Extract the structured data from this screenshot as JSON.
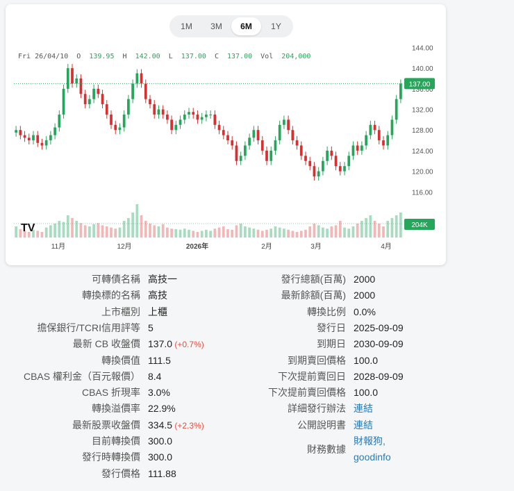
{
  "range_tabs": [
    {
      "label": "1M",
      "active": false
    },
    {
      "label": "3M",
      "active": false
    },
    {
      "label": "6M",
      "active": true
    },
    {
      "label": "1Y",
      "active": false
    }
  ],
  "legend": {
    "date": "Fri 26/04/10",
    "o_label": "O",
    "o": "139.95",
    "h_label": "H",
    "h": "142.00",
    "l_label": "L",
    "l": "137.00",
    "c_label": "C",
    "c": "137.00",
    "vol_label": "Vol",
    "vol": "204,000"
  },
  "chart_data": {
    "type": "candlestick",
    "y_ticks": [
      "144.00",
      "140.00",
      "136.00",
      "132.00",
      "128.00",
      "124.00",
      "120.00",
      "116.00"
    ],
    "y_tick_values": [
      144,
      140,
      136,
      132,
      128,
      124,
      120,
      116
    ],
    "ylim": [
      112,
      145
    ],
    "x_ticks": [
      "11月",
      "12月",
      "2026年",
      "2月",
      "3月",
      "4月"
    ],
    "last_price_label": "137.00",
    "last_price": 137.0,
    "last_volume_label": "204K",
    "up_color": "#26a65b",
    "down_color": "#d63031",
    "closes": [
      128,
      127,
      126.5,
      126,
      127,
      125.5,
      125,
      126,
      127,
      128.5,
      131,
      136,
      140,
      137,
      138,
      135,
      133,
      134,
      136,
      135,
      133,
      131,
      129,
      128,
      128.5,
      131,
      134,
      137,
      139,
      137,
      134,
      133,
      131,
      132,
      131,
      130,
      128,
      129,
      130,
      131,
      131.5,
      131,
      130,
      130.5,
      131,
      131,
      129,
      128,
      127,
      126,
      125,
      122,
      123,
      125,
      126.5,
      128,
      126,
      124,
      122,
      124,
      126,
      129,
      130,
      128,
      126,
      125,
      123,
      122,
      121,
      119,
      120,
      122,
      124,
      123,
      121,
      120,
      121,
      123,
      125,
      124,
      125,
      127,
      129,
      128,
      126,
      125,
      127,
      130,
      134,
      137
    ],
    "volumes": [
      20,
      15,
      12,
      10,
      14,
      12,
      10,
      18,
      22,
      25,
      30,
      28,
      40,
      35,
      30,
      26,
      22,
      20,
      24,
      26,
      22,
      20,
      18,
      16,
      18,
      30,
      35,
      45,
      60,
      40,
      30,
      25,
      22,
      20,
      24,
      18,
      16,
      15,
      14,
      16,
      14,
      12,
      10,
      12,
      14,
      12,
      16,
      18,
      20,
      15,
      14,
      22,
      25,
      20,
      18,
      16,
      14,
      12,
      14,
      16,
      20,
      18,
      16,
      14,
      12,
      10,
      12,
      14,
      20,
      25,
      22,
      18,
      16,
      20,
      22,
      30,
      18,
      16,
      20,
      25,
      30,
      35,
      40,
      30,
      25,
      20,
      30,
      35,
      40,
      45
    ]
  },
  "info_left": [
    {
      "label": "可轉債名稱",
      "value": "高技一"
    },
    {
      "label": "轉換標的名稱",
      "value": "高技"
    },
    {
      "label": "上市櫃別",
      "value": "上櫃"
    },
    {
      "label": "擔保銀行/TCRI信用評等",
      "value": "5"
    },
    {
      "label": "最新 CB 收盤價",
      "value": "137.0",
      "change": "(+0.7%)"
    },
    {
      "label": "轉換價值",
      "value": "111.5"
    },
    {
      "label": "CBAS 權利金（百元報價）",
      "value": "8.4"
    },
    {
      "label": "CBAS 折現率",
      "value": "3.0%"
    },
    {
      "label": "轉換溢價率",
      "value": "22.9%"
    },
    {
      "label": "最新股票收盤價",
      "value": "334.5",
      "change": "(+2.3%)"
    },
    {
      "label": "目前轉換價",
      "value": "300.0"
    },
    {
      "label": "發行時轉換價",
      "value": "300.0"
    },
    {
      "label": "發行價格",
      "value": "111.88"
    }
  ],
  "info_right": [
    {
      "label": "發行總額(百萬)",
      "value": "2000"
    },
    {
      "label": "最新餘額(百萬)",
      "value": "2000"
    },
    {
      "label": "轉換比例",
      "value": "0.0%"
    },
    {
      "label": "發行日",
      "value": "2025-09-09"
    },
    {
      "label": "到期日",
      "value": "2030-09-09"
    },
    {
      "label": "到期賣回價格",
      "value": "100.0"
    },
    {
      "label": "下次提前賣回日",
      "value": "2028-09-09"
    },
    {
      "label": "下次提前賣回價格",
      "value": "100.0"
    },
    {
      "label": "詳細發行辦法",
      "value": "連結",
      "link": true
    },
    {
      "label": "公開說明書",
      "value": "連結",
      "link": true
    }
  ],
  "financial": {
    "label": "財務數據",
    "link1": "財報狗,",
    "link2": "goodinfo"
  },
  "logo_text": "TV"
}
